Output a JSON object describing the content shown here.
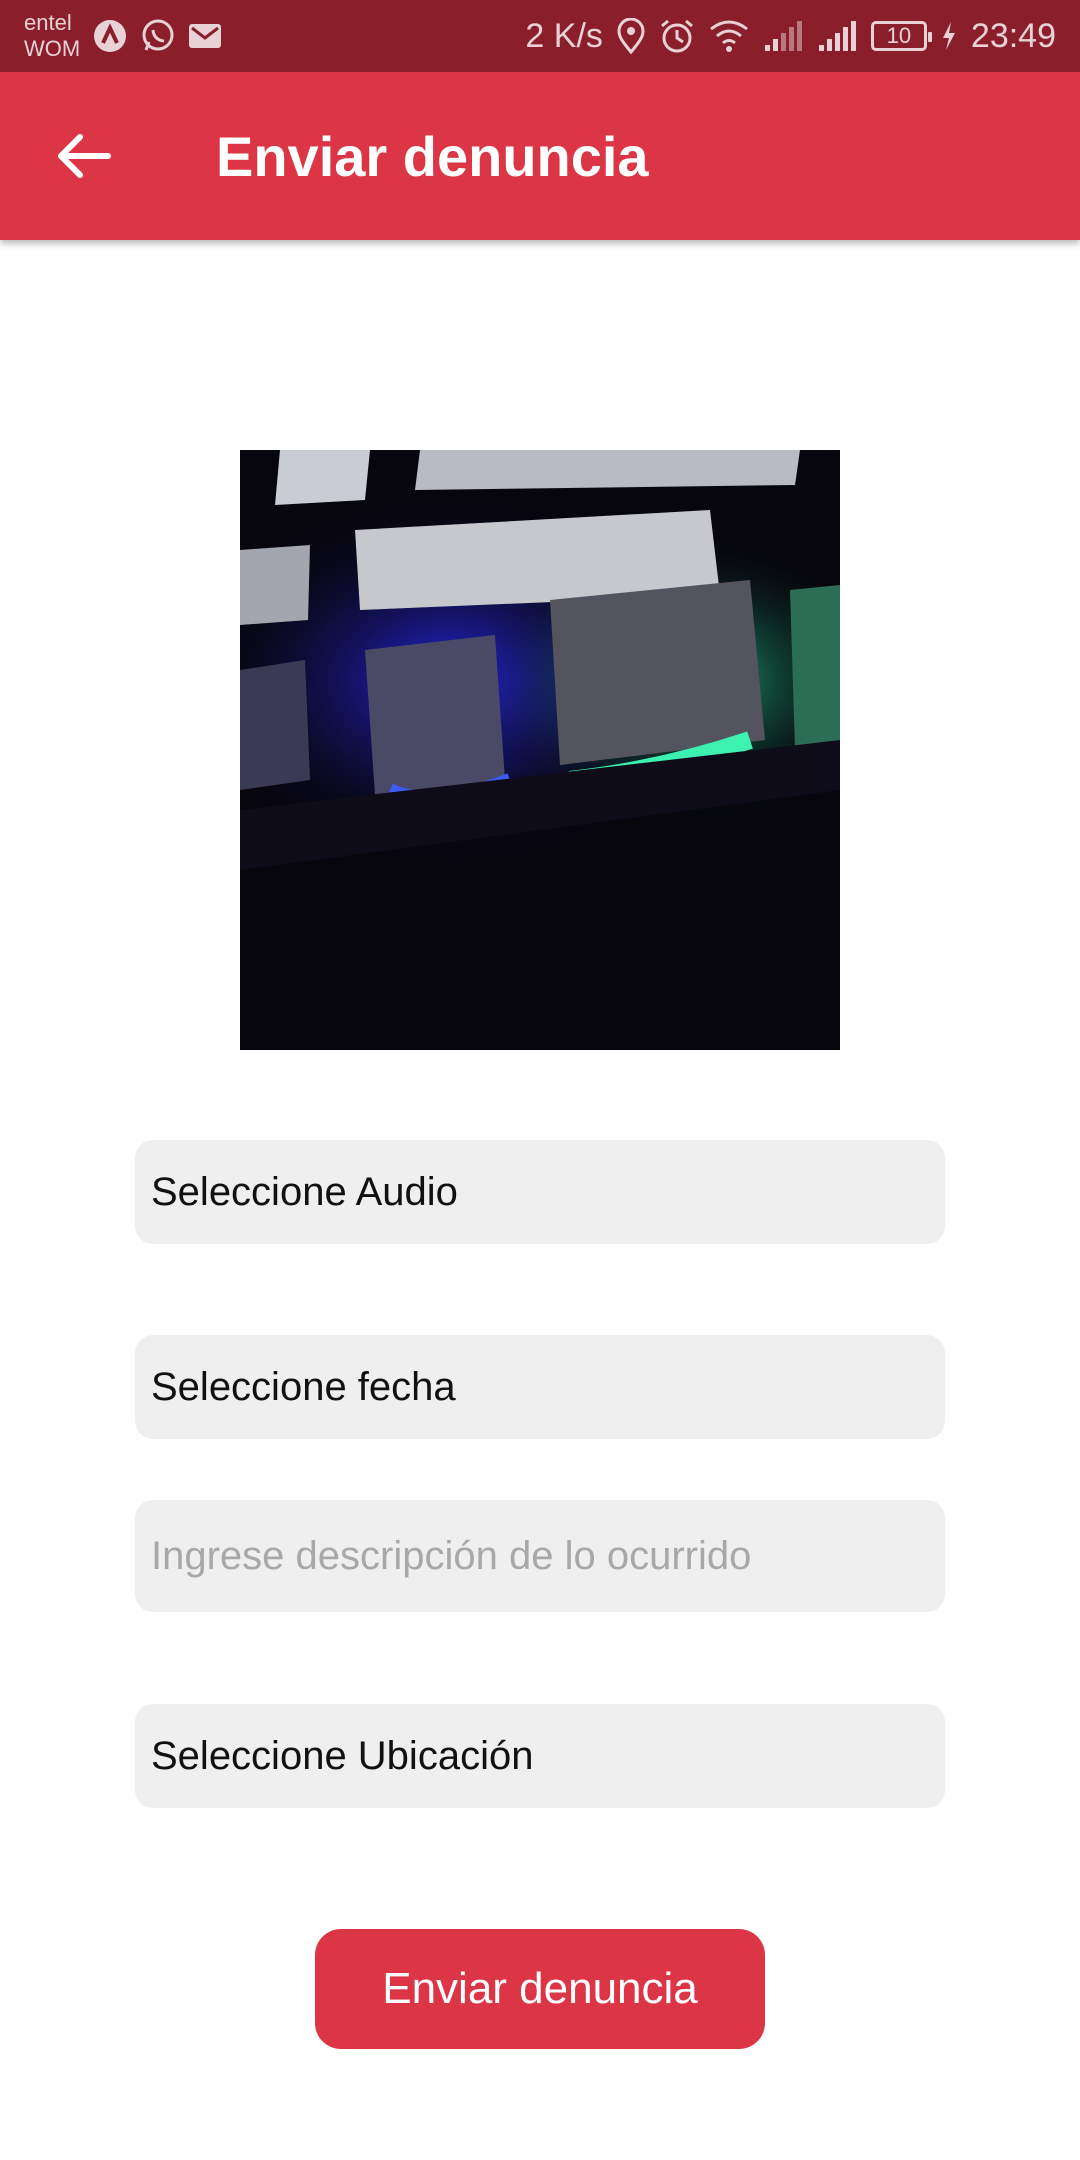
{
  "status_bar": {
    "carrier_1": "entel",
    "carrier_2": "WOM",
    "speed": "2 K/s",
    "battery": "10",
    "time": "23:49",
    "icons": [
      "app-icon",
      "whatsapp-icon",
      "gmail-icon",
      "location-icon",
      "alarm-icon",
      "wifi-icon",
      "signal-icon",
      "signal-icon",
      "battery-icon",
      "charging-icon"
    ]
  },
  "app_bar": {
    "title": "Enviar denuncia",
    "color": "#dc3545",
    "back_icon": "arrow-left-icon"
  },
  "form": {
    "image_preview": "keyboard-photo",
    "audio_label": "Seleccione Audio",
    "date_label": "Seleccione fecha",
    "description_placeholder": "Ingrese descripción de lo ocurrido",
    "location_label": "Seleccione Ubicación",
    "submit_label": "Enviar denuncia"
  }
}
